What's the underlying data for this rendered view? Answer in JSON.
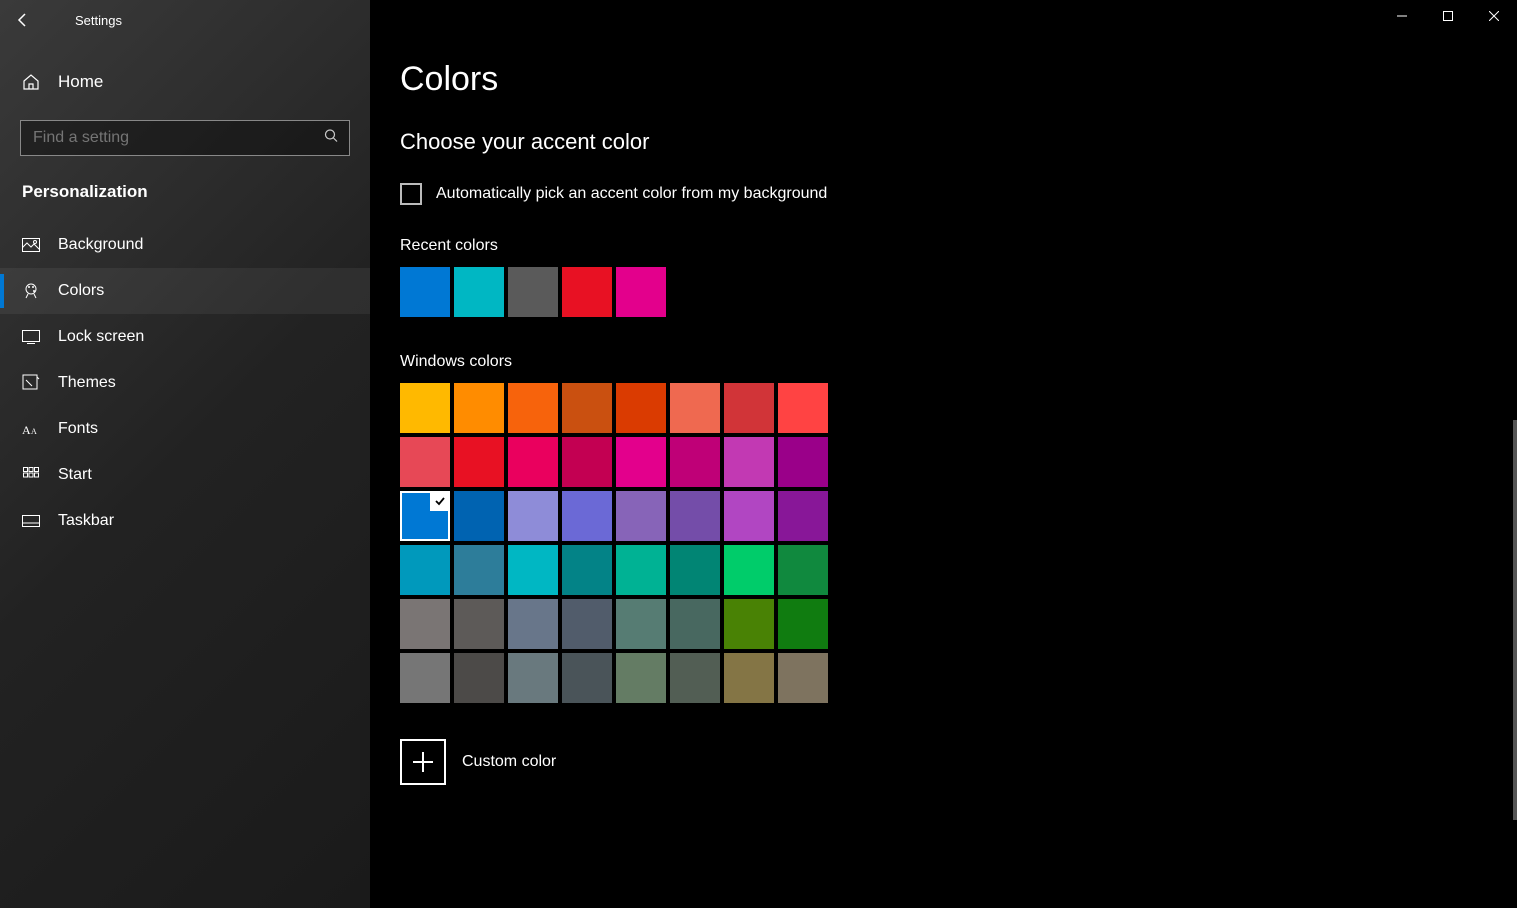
{
  "titlebar": {
    "title": "Settings"
  },
  "sidebar": {
    "home_label": "Home",
    "search_placeholder": "Find a setting",
    "category": "Personalization",
    "items": [
      {
        "label": "Background"
      },
      {
        "label": "Colors"
      },
      {
        "label": "Lock screen"
      },
      {
        "label": "Themes"
      },
      {
        "label": "Fonts"
      },
      {
        "label": "Start"
      },
      {
        "label": "Taskbar"
      }
    ],
    "active_index": 1
  },
  "main": {
    "page_title": "Colors",
    "section_title": "Choose your accent color",
    "auto_checkbox_label": "Automatically pick an accent color from my background",
    "auto_checked": false,
    "recent_label": "Recent colors",
    "recent_colors": [
      "#0078d4",
      "#00b7c3",
      "#5a5a5a",
      "#e81123",
      "#e3008c"
    ],
    "windows_label": "Windows colors",
    "windows_colors": [
      "#ffb900",
      "#ff8c00",
      "#f7630c",
      "#ca5010",
      "#da3b01",
      "#ef6950",
      "#d13438",
      "#ff4343",
      "#e74856",
      "#e81123",
      "#ea005e",
      "#c30052",
      "#e3008c",
      "#bf0077",
      "#c239b3",
      "#9a0089",
      "#0078d4",
      "#0063b1",
      "#8e8cd8",
      "#6b69d6",
      "#8764b8",
      "#744da9",
      "#b146c2",
      "#881798",
      "#0099bc",
      "#2d7d9a",
      "#00b7c3",
      "#038387",
      "#00b294",
      "#018574",
      "#00cc6a",
      "#10893e",
      "#7a7574",
      "#5d5a58",
      "#68768a",
      "#515c6b",
      "#567c73",
      "#486860",
      "#498205",
      "#107c10",
      "#767676",
      "#4c4a48",
      "#69797e",
      "#4a5459",
      "#647c64",
      "#525e54",
      "#847545",
      "#7e735f"
    ],
    "selected_color_index": 16,
    "custom_label": "Custom color"
  }
}
